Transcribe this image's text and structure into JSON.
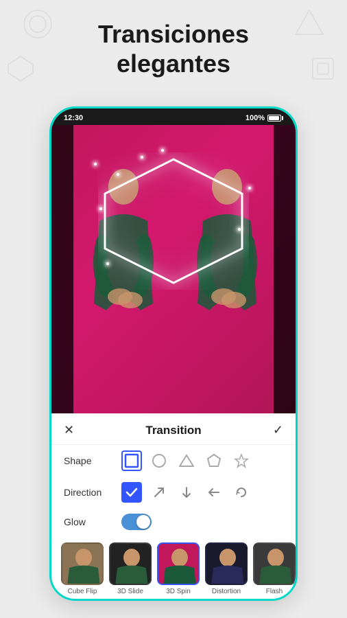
{
  "title": {
    "line1": "Transiciones",
    "line2": "elegantes"
  },
  "status_bar": {
    "time": "12:30",
    "battery": "100%"
  },
  "transition_panel": {
    "close_label": "✕",
    "title": "Transition",
    "confirm_label": "✓",
    "shape_label": "Shape",
    "direction_label": "Direction",
    "glow_label": "Glow"
  },
  "shapes": [
    {
      "id": "square",
      "active": true
    },
    {
      "id": "circle",
      "active": false
    },
    {
      "id": "triangle",
      "active": false
    },
    {
      "id": "pentagon",
      "active": false
    },
    {
      "id": "star",
      "active": false
    }
  ],
  "directions": [
    {
      "id": "check",
      "active": true
    },
    {
      "id": "up-right",
      "active": false
    },
    {
      "id": "down",
      "active": false
    },
    {
      "id": "left",
      "active": false
    },
    {
      "id": "rotate",
      "active": false
    }
  ],
  "thumbnails": [
    {
      "label": "Cube Flip",
      "active": false,
      "color": "thumb-1"
    },
    {
      "label": "3D Slide",
      "active": false,
      "color": "thumb-2"
    },
    {
      "label": "3D Spin",
      "active": true,
      "color": "thumb-3"
    },
    {
      "label": "Distortion",
      "active": false,
      "color": "thumb-4"
    },
    {
      "label": "Flash",
      "active": false,
      "color": "thumb-5"
    }
  ],
  "colors": {
    "accent": "#00d9c8",
    "active_blue": "#3355ff",
    "toggle_blue": "#4a90d9"
  }
}
